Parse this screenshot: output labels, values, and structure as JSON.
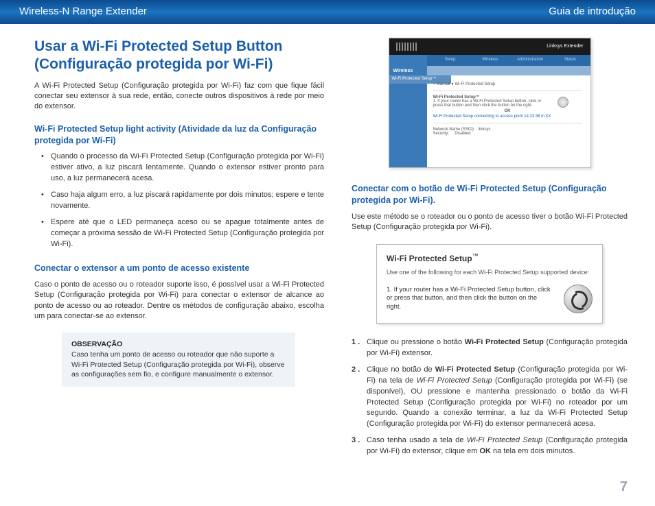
{
  "header": {
    "left": "Wireless-N Range Extender",
    "right": "Guia de introdução"
  },
  "main_heading": "Usar a Wi-Fi Protected Setup Button (Configuração protegida por Wi-Fi)",
  "intro": "A Wi-Fi Protected Setup (Configuração protegida por Wi-Fi) faz com que fique fácil conectar seu extensor à sua rede, então, conecte outros dispositivos à rede por meio do extensor.",
  "section1_heading": "Wi-Fi Protected Setup light activity (Atividade da luz da Configuração protegida por Wi-Fi)",
  "bullets": [
    "Quando o processo da Wi-Fi Protected Setup (Configuração protegida por Wi-Fi) estiver ativo, a luz piscará lentamente. Quando o extensor estiver pronto para uso, a luz permanecerá acesa.",
    "Caso haja algum erro, a luz piscará rapidamente por dois minutos; espere e tente novamente.",
    "Espere até que o LED permaneça aceso ou se apague totalmente antes de começar a próxima sessão de Wi-Fi Protected Setup (Configuração protegida por Wi-Fi)."
  ],
  "section2_heading": "Conectar o extensor a um ponto de acesso existente",
  "section2_body": "Caso o ponto de acesso ou o roteador suporte isso, é possível usar a Wi-Fi Protected Setup (Configuração protegida por Wi-Fi) para conectar o extensor de alcance ao ponto de acesso ou ao roteador. Dentre os métodos de configuração abaixo, escolha um para conectar-se ao extensor.",
  "note": {
    "label": "OBSERVAÇÃO",
    "body": "Caso tenha um ponto de acesso ou roteador que não suporte a Wi-Fi Protected Setup (Configuração protegida por Wi-Fi), observe as configurações sem fio, e configure manualmente o extensor."
  },
  "right_heading": "Conectar com o botão de Wi-Fi Protected Setup (Configuração protegida por Wi-Fi).",
  "right_intro": "Use este método se o roteador ou o ponto de acesso tiver o botão Wi-Fi Protected Setup (Configuração protegida por Wi-Fi).",
  "wps_box": {
    "title_a": "Wi-Fi ",
    "title_b": "Protected Setup",
    "tm": "™",
    "sub": "Use one of the following for each Wi-Fi Protected Setup supported device:",
    "row": "1. If your router has a Wi-Fi Protected Setup button, click or press that button, and then click the button on the right."
  },
  "screenshot": {
    "firmware": "Linksys Extender",
    "wireless": "Wireless",
    "tabs": [
      "Setup",
      "Wireless",
      "Administration",
      "Status"
    ],
    "tag": "Wi-Fi Protected Setup™",
    "line1": "○ Manual  ● Wi-Fi Protected Setup",
    "line2h": "Wi-Fi Protected Setup™",
    "line2": "1. If your router has a Wi-Fi Protected Setup button, click or press that button and then click the button on the right.",
    "ok": "OK",
    "status": "Wi-Fi Protected Setup connecting to access point 14:23:38 in XX",
    "net_label": "Network Name (SSID):",
    "sec_label": "Security:",
    "net_val": "linksys",
    "sec_val": "Disabled"
  },
  "steps": {
    "s1a": "Clique ou pressione o botão ",
    "s1b": "Wi-Fi Protected Setup",
    "s1c": " (Configuração protegida por Wi-Fi) extensor.",
    "s2a": "Clique no botão de ",
    "s2b": "Wi-Fi Protected Setup",
    "s2c": " (Configuração protegida por Wi-Fi) na tela de ",
    "s2d": "Wi-Fi Protected Setup",
    "s2e": " (Configuração protegida por Wi-Fi) (se disponível), OU pressione e mantenha pressionado o botão da Wi-Fi Protected Setup (Configuração protegida por Wi-Fi) no roteador por um segundo. Quando a conexão terminar, a luz da Wi-Fi Protected Setup (Configuração protegida por Wi-Fi) do extensor permanecerá acesa.",
    "s3a": "Caso tenha usado a tela de ",
    "s3b": "Wi-Fi Protected Setup",
    "s3c": " (Configuração protegida por Wi-Fi) do extensor, clique em ",
    "s3d": "OK",
    "s3e": " na tela em dois minutos."
  },
  "page_number": "7"
}
